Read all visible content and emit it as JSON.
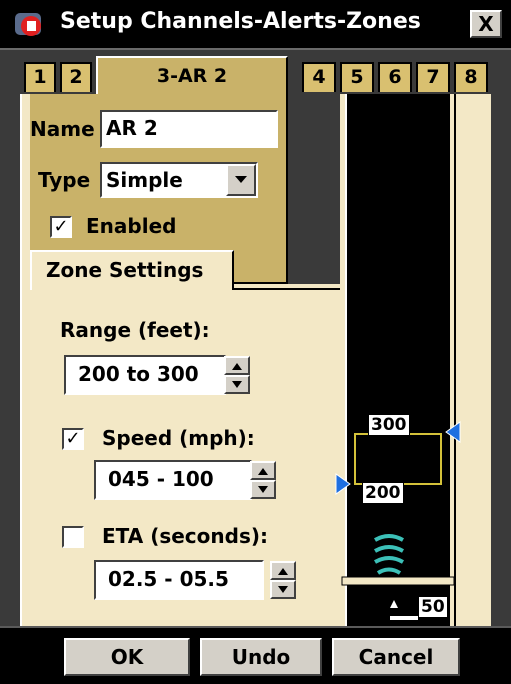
{
  "window": {
    "title": "Setup Channels-Alerts-Zones",
    "close_label": "X"
  },
  "tabs": [
    {
      "label": "1"
    },
    {
      "label": "2"
    },
    {
      "label": "3-AR 2",
      "active": true
    },
    {
      "label": "4"
    },
    {
      "label": "5"
    },
    {
      "label": "6"
    },
    {
      "label": "7"
    },
    {
      "label": "8"
    }
  ],
  "form": {
    "name_label": "Name",
    "name_value": "AR 2",
    "type_label": "Type",
    "type_value": "Simple",
    "enabled_label": "Enabled",
    "enabled_checked": true
  },
  "zone": {
    "tab_label": "Zone Settings",
    "range_label": "Range (feet):",
    "range_value": "200 to 300",
    "speed_label": "Speed (mph):",
    "speed_checked": true,
    "speed_value": "045 - 100",
    "eta_label": "ETA (seconds):",
    "eta_checked": false,
    "eta_value": "02.5 - 05.5"
  },
  "graph": {
    "upper_label": "300",
    "lower_label": "200",
    "base_label": "50"
  },
  "buttons": {
    "ok": "OK",
    "undo": "Undo",
    "cancel": "Cancel"
  },
  "colors": {
    "tab": "#d9c070",
    "panel": "#f3e8c6",
    "marker": "#1e6fe0",
    "zone_box": "#d4c23a",
    "signal": "#3cc0b8"
  }
}
